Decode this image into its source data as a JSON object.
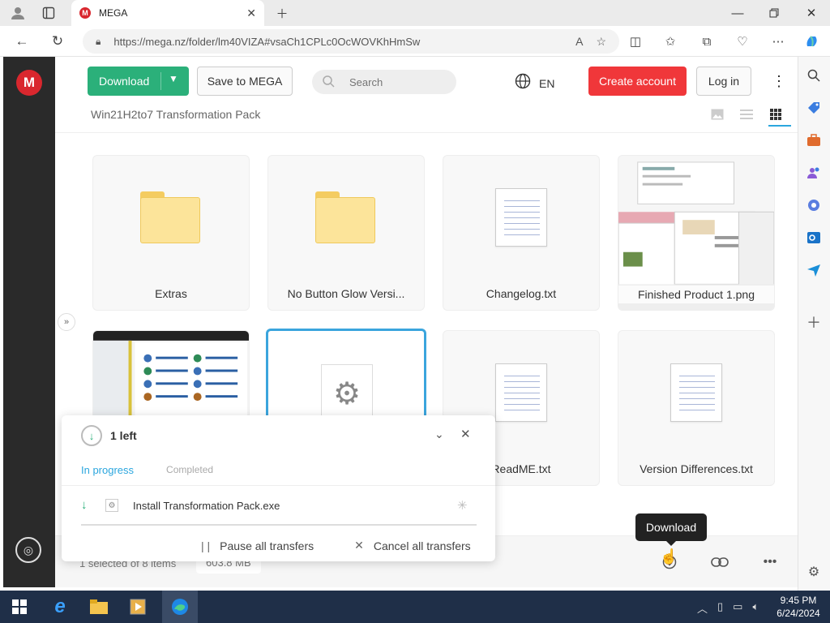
{
  "browser": {
    "tab_title": "MEGA",
    "url": "https://mega.nz/folder/lm40VIZA#vsaCh1CPLc0OcWOVKhHmSw"
  },
  "toolbar": {
    "download_label": "Download",
    "save_label": "Save to MEGA",
    "search_placeholder": "Search",
    "language": "EN",
    "create_account_label": "Create account",
    "login_label": "Log in"
  },
  "breadcrumb": "Win21H2to7 Transformation Pack",
  "files": [
    {
      "name": "Extras",
      "kind": "folder"
    },
    {
      "name": "No Button Glow Versi...",
      "kind": "folder"
    },
    {
      "name": "Changelog.txt",
      "kind": "text"
    },
    {
      "name": "Finished Product 1.png",
      "kind": "image"
    },
    {
      "name": "",
      "kind": "image"
    },
    {
      "name": "",
      "kind": "exe",
      "selected": true
    },
    {
      "name": "ReadME.txt",
      "kind": "text"
    },
    {
      "name": "Version Differences.txt",
      "kind": "text"
    }
  ],
  "footer": {
    "selection": "1 selected of 8 items",
    "size": "603.8 MB",
    "tooltip": "Download"
  },
  "transfers": {
    "count_label": "1 left",
    "tab_in_progress": "In progress",
    "tab_completed": "Completed",
    "items": [
      {
        "name": "Install Transformation Pack.exe"
      }
    ],
    "pause_label": "Pause all transfers",
    "cancel_label": "Cancel all transfers"
  },
  "taskbar": {
    "time": "9:45 PM",
    "date": "6/24/2024"
  },
  "colors": {
    "download_green": "#2bb07a",
    "create_red": "#f0373a",
    "mega_red": "#d9272e",
    "selection_blue": "#3ba5dd"
  }
}
